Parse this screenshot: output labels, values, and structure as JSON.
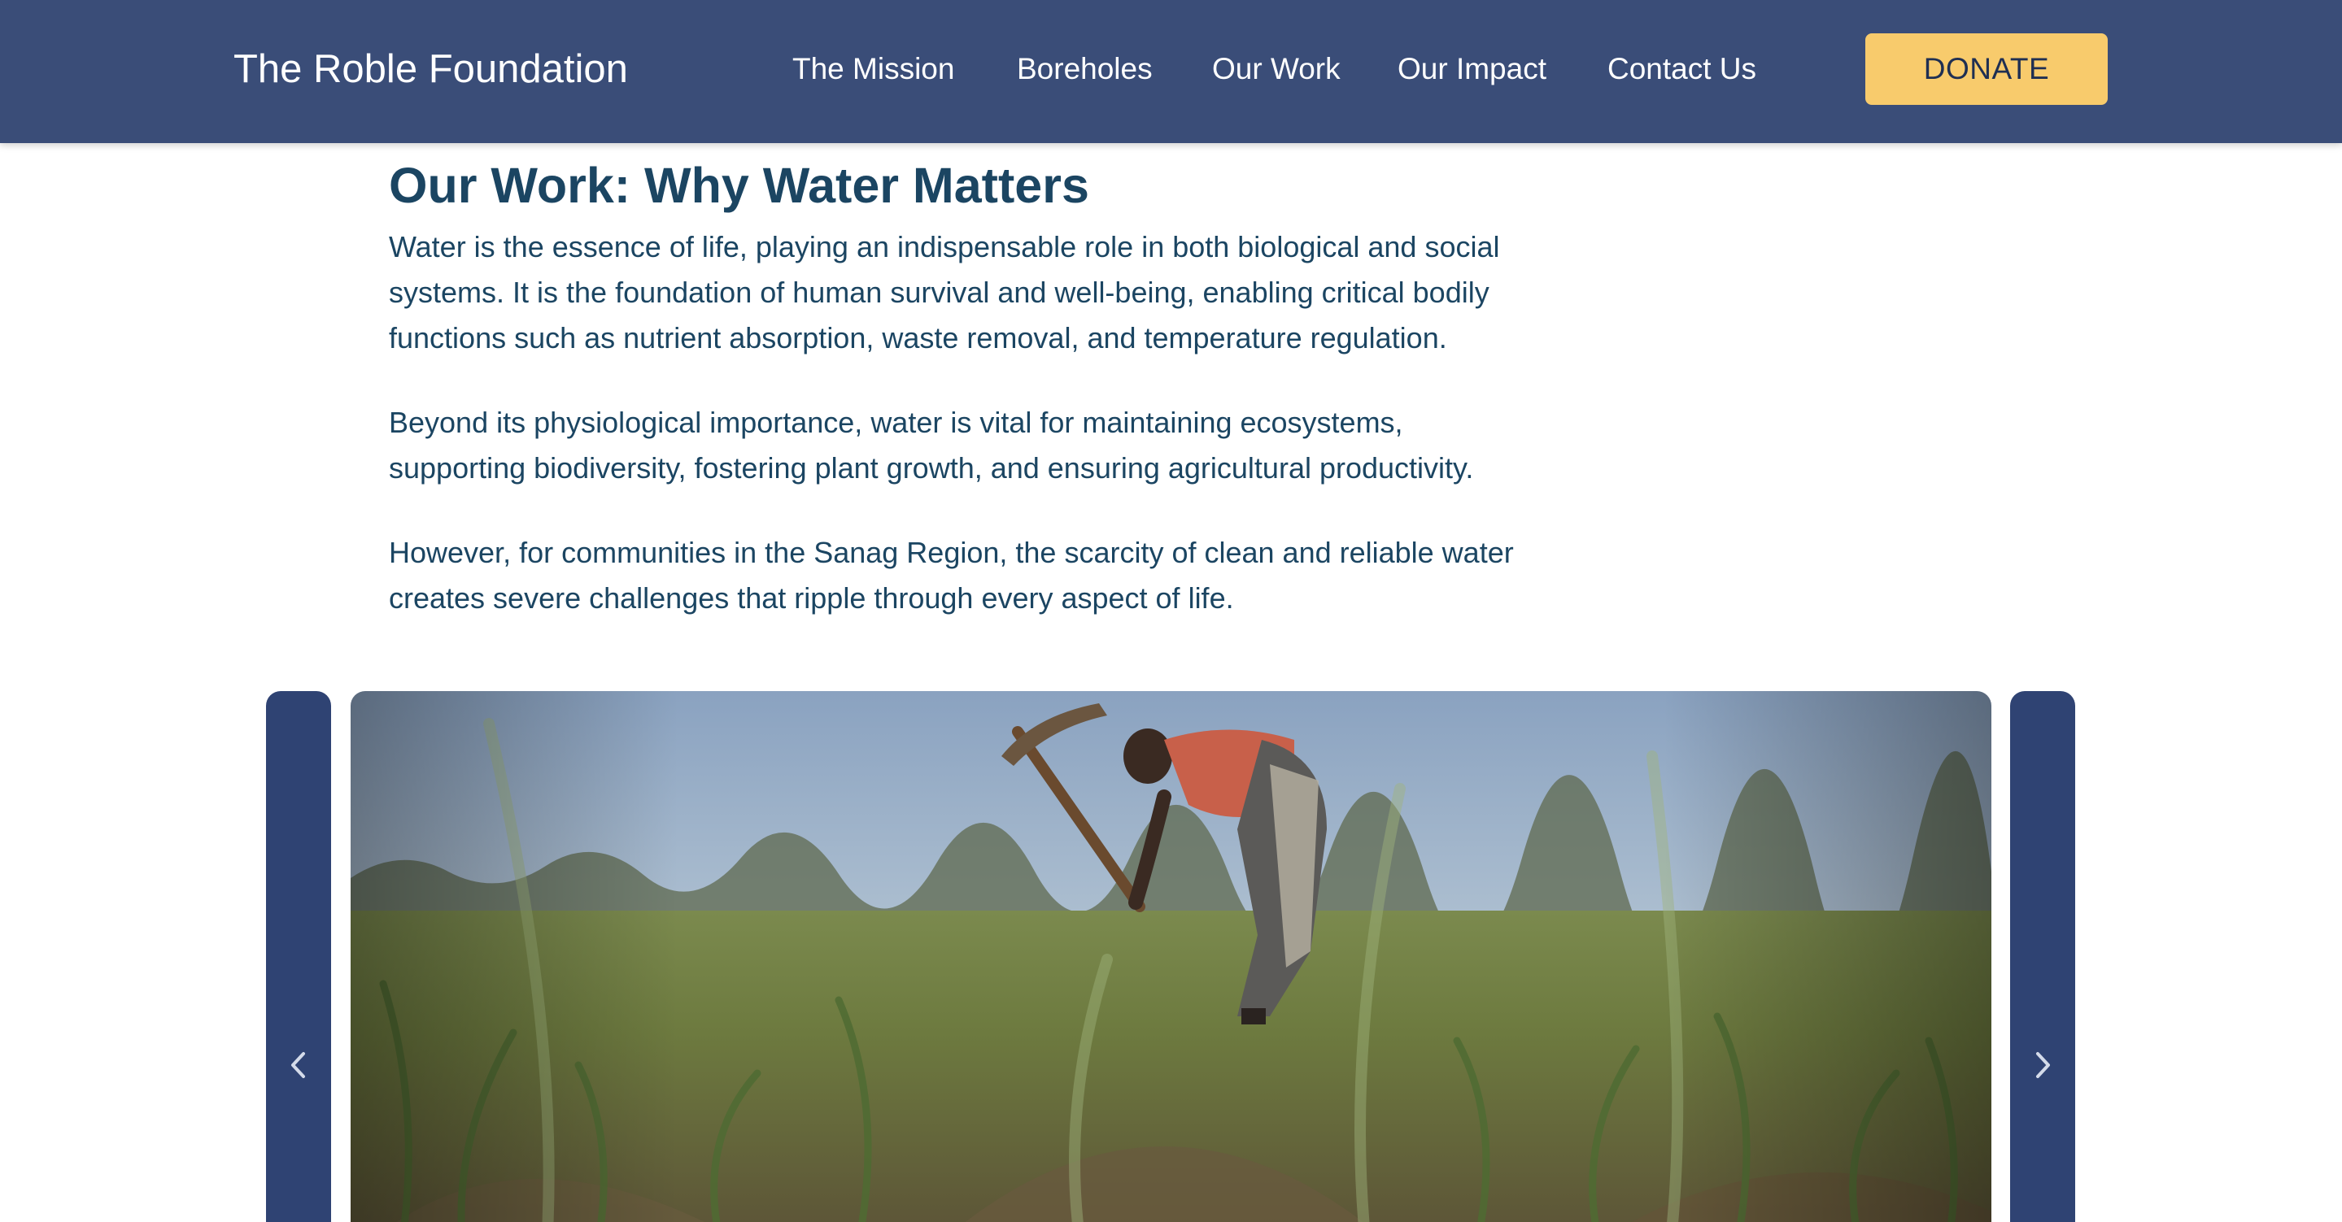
{
  "header": {
    "brand": "The Roble Foundation",
    "nav": [
      "The Mission",
      "Boreholes",
      "Our Work",
      "Our Impact",
      "Contact Us"
    ],
    "donate_label": "DONATE"
  },
  "article": {
    "title": "Our Work: Why Water Matters",
    "paragraphs": [
      "Water is the essence of life, playing an indispensable role in both biological and social systems. It is the foundation of human survival and well-being, enabling critical bodily functions such as nutrient absorption, waste removal, and temperature regulation.",
      "Beyond its physiological importance, water is vital for maintaining ecosystems, supporting biodiversity, fostering plant growth, and ensuring agricultural productivity.",
      "However, for communities in the Sanag Region, the scarcity of clean and reliable water creates severe challenges that ripple through every aspect of life."
    ]
  },
  "carousel": {
    "prev_icon": "chevron-left-icon",
    "next_icon": "chevron-right-icon"
  },
  "colors": {
    "header_bg": "#3a4d78",
    "accent": "#f8cb6c",
    "text": "#1b4562",
    "carousel_nav": "#2f4373"
  }
}
